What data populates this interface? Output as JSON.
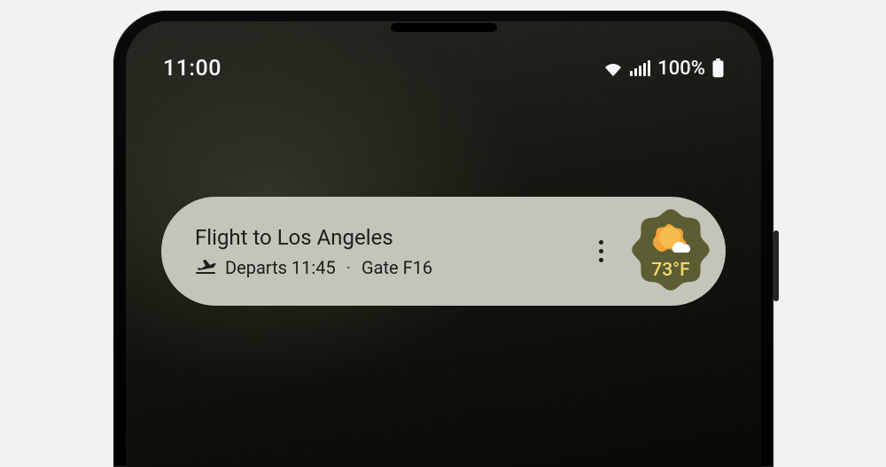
{
  "statusbar": {
    "time": "11:00",
    "battery_percent": "100%"
  },
  "widget": {
    "title": "Flight to Los Angeles",
    "departs_label": "Departs 11:45",
    "gate_label": "Gate F16"
  },
  "weather": {
    "temperature": "73°F"
  }
}
